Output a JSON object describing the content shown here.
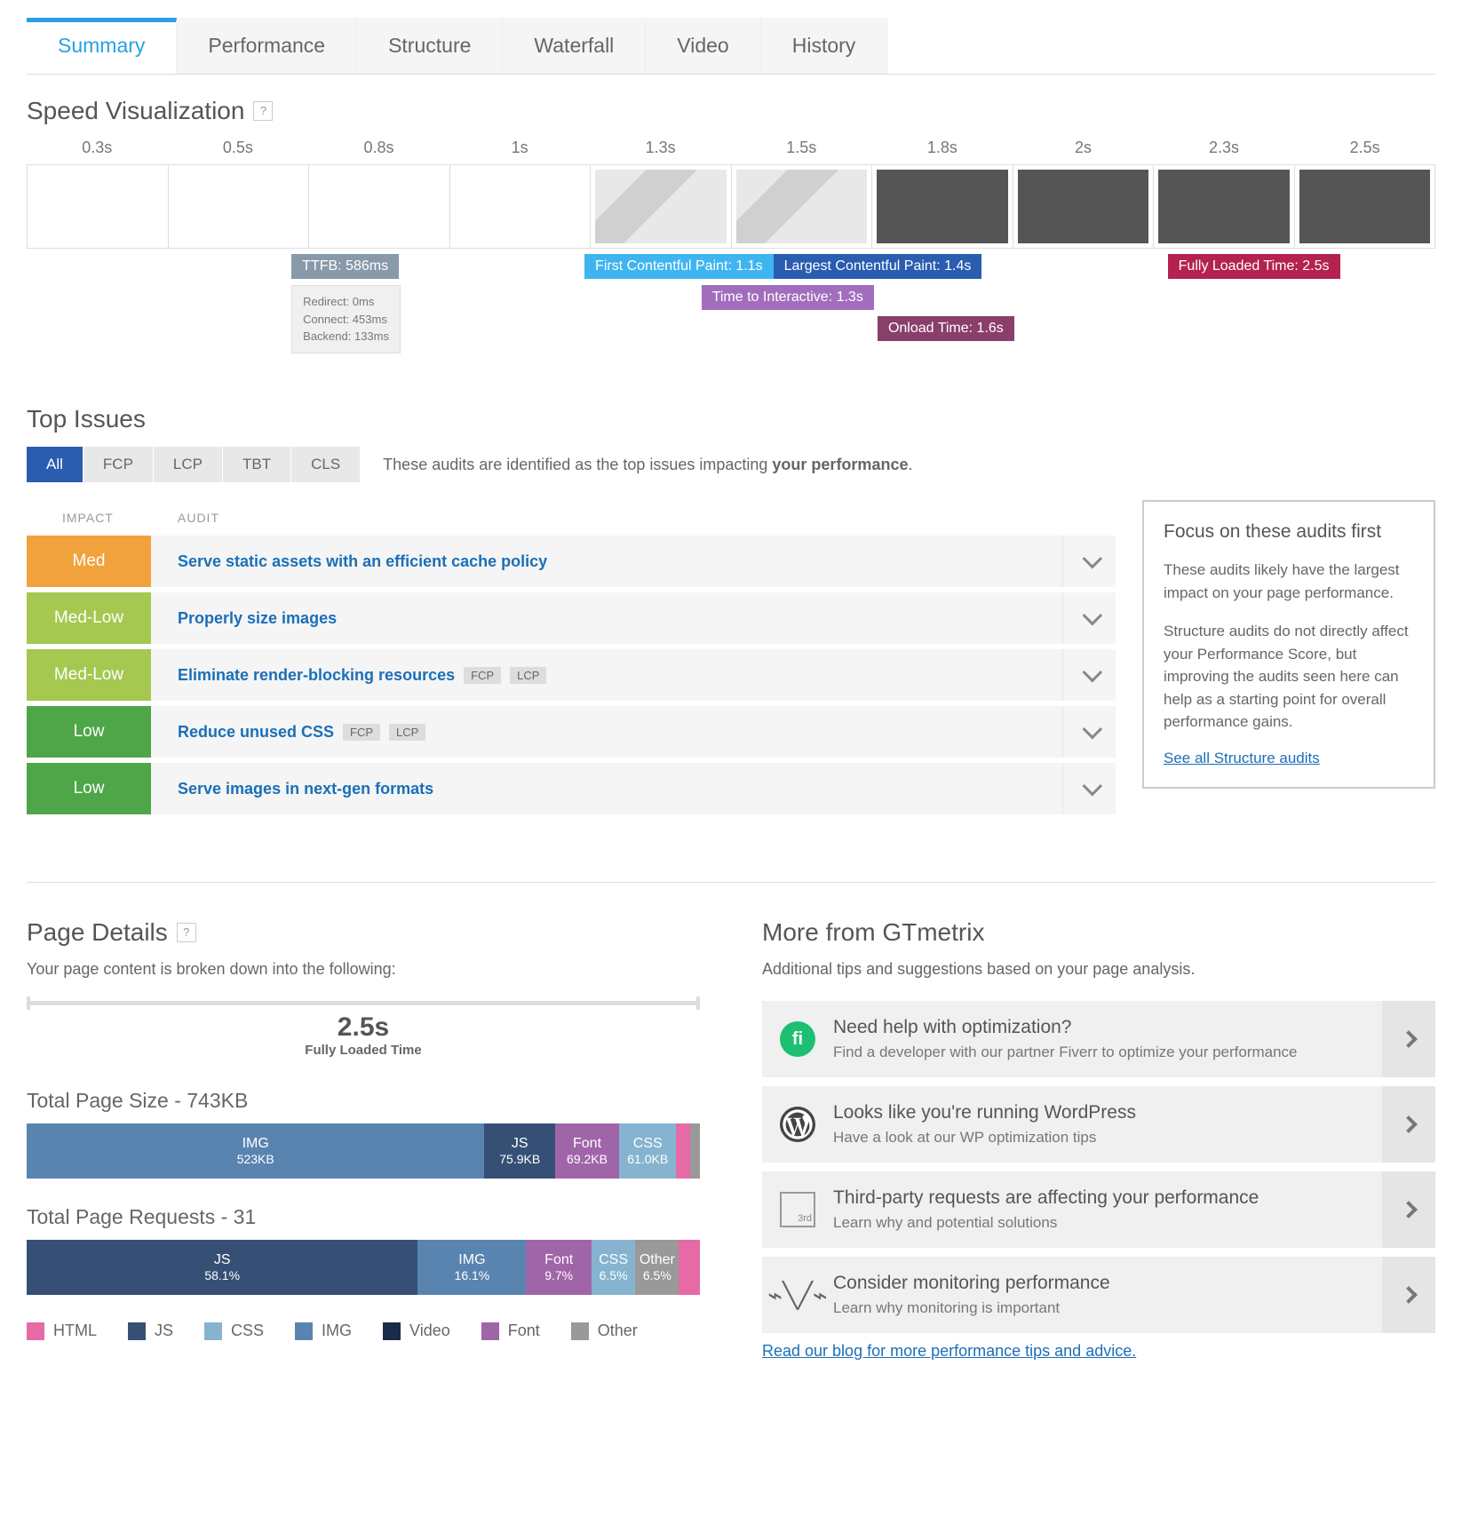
{
  "tabs": [
    "Summary",
    "Performance",
    "Structure",
    "Waterfall",
    "Video",
    "History"
  ],
  "speed": {
    "title": "Speed Visualization",
    "ticks": [
      "0.3s",
      "0.5s",
      "0.8s",
      "1s",
      "1.3s",
      "1.5s",
      "1.8s",
      "2s",
      "2.3s",
      "2.5s"
    ],
    "ttfb": "TTFB: 586ms",
    "ttfb_details": [
      "Redirect: 0ms",
      "Connect: 453ms",
      "Backend: 133ms"
    ],
    "fcp": "First Contentful Paint: 1.1s",
    "lcp": "Largest Contentful Paint: 1.4s",
    "tti": "Time to Interactive: 1.3s",
    "onload": "Onload Time: 1.6s",
    "flt": "Fully Loaded Time: 2.5s"
  },
  "issues": {
    "title": "Top Issues",
    "filters": [
      "All",
      "FCP",
      "LCP",
      "TBT",
      "CLS"
    ],
    "desc_pre": "These audits are identified as the top issues impacting ",
    "desc_bold": "your performance",
    "col_impact": "IMPACT",
    "col_audit": "AUDIT",
    "rows": [
      {
        "impact": "Med",
        "impact_class": "impact-med",
        "audit": "Serve static assets with an efficient cache policy",
        "tags": []
      },
      {
        "impact": "Med-Low",
        "impact_class": "impact-medlow",
        "audit": "Properly size images",
        "tags": []
      },
      {
        "impact": "Med-Low",
        "impact_class": "impact-medlow",
        "audit": "Eliminate render-blocking resources",
        "tags": [
          "FCP",
          "LCP"
        ]
      },
      {
        "impact": "Low",
        "impact_class": "impact-low",
        "audit": "Reduce unused CSS",
        "tags": [
          "FCP",
          "LCP"
        ]
      },
      {
        "impact": "Low",
        "impact_class": "impact-low",
        "audit": "Serve images in next-gen formats",
        "tags": []
      }
    ],
    "focus": {
      "title": "Focus on these audits first",
      "p1": "These audits likely have the largest impact on your page performance.",
      "p2": "Structure audits do not directly affect your Performance Score, but improving the audits seen here can help as a starting point for overall performance gains.",
      "link": "See all Structure audits"
    }
  },
  "details": {
    "title": "Page Details",
    "sub": "Your page content is broken down into the following:",
    "flt_val": "2.5s",
    "flt_lbl": "Fully Loaded Time",
    "size_title": "Total Page Size - 743KB",
    "size_segs": [
      {
        "name": "IMG",
        "val": "523KB",
        "class": "c-img",
        "pct": 68
      },
      {
        "name": "JS",
        "val": "75.9KB",
        "class": "c-js",
        "pct": 10.5
      },
      {
        "name": "Font",
        "val": "69.2KB",
        "class": "c-font",
        "pct": 9.5
      },
      {
        "name": "CSS",
        "val": "61.0KB",
        "class": "c-css",
        "pct": 8.5
      },
      {
        "name": "",
        "val": "",
        "class": "c-html",
        "pct": 2
      },
      {
        "name": "",
        "val": "",
        "class": "c-other",
        "pct": 1.5
      }
    ],
    "req_title": "Total Page Requests - 31",
    "req_segs": [
      {
        "name": "JS",
        "val": "58.1%",
        "class": "c-js",
        "pct": 58.1
      },
      {
        "name": "IMG",
        "val": "16.1%",
        "class": "c-img",
        "pct": 16.1
      },
      {
        "name": "Font",
        "val": "9.7%",
        "class": "c-font",
        "pct": 9.7
      },
      {
        "name": "CSS",
        "val": "6.5%",
        "class": "c-css",
        "pct": 6.5
      },
      {
        "name": "Other",
        "val": "6.5%",
        "class": "c-other",
        "pct": 6.5
      },
      {
        "name": "",
        "val": "",
        "class": "c-html",
        "pct": 3.1
      }
    ],
    "legend": [
      {
        "label": "HTML",
        "class": "c-html"
      },
      {
        "label": "JS",
        "class": "c-js"
      },
      {
        "label": "CSS",
        "class": "c-css"
      },
      {
        "label": "IMG",
        "class": "c-img"
      },
      {
        "label": "Video",
        "class": "c-video"
      },
      {
        "label": "Font",
        "class": "c-font"
      },
      {
        "label": "Other",
        "class": "c-other"
      }
    ]
  },
  "more": {
    "title": "More from GTmetrix",
    "sub": "Additional tips and suggestions based on your page analysis.",
    "items": [
      {
        "title": "Need help with optimization?",
        "desc": "Find a developer with our partner Fiverr to optimize your performance",
        "icon": "fiverr"
      },
      {
        "title": "Looks like you're running WordPress",
        "desc": "Have a look at our WP optimization tips",
        "icon": "wordpress"
      },
      {
        "title": "Third-party requests are affecting your performance",
        "desc": "Learn why and potential solutions",
        "icon": "third"
      },
      {
        "title": "Consider monitoring performance",
        "desc": "Learn why monitoring is important",
        "icon": "pulse"
      }
    ],
    "blog": "Read our blog for more performance tips and advice."
  }
}
